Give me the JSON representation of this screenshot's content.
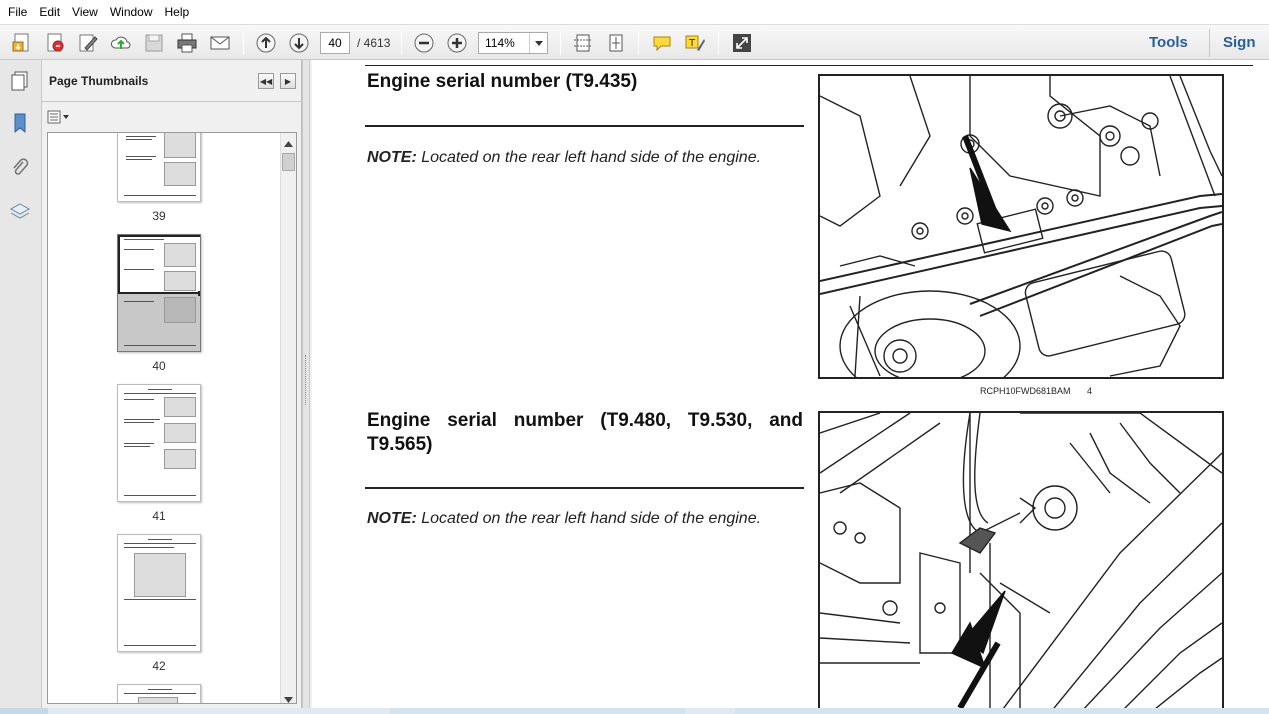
{
  "menu": [
    "File",
    "Edit",
    "View",
    "Window",
    "Help"
  ],
  "toolbar": {
    "icons": [
      "create-pdf-icon",
      "export-pdf-icon",
      "edit-icon",
      "upload-cloud-icon",
      "save-icon",
      "print-icon",
      "email-icon",
      "page-up-icon",
      "page-down-icon",
      "zoom-out-icon",
      "zoom-in-icon",
      "fit-width-icon",
      "fit-page-icon",
      "comment-icon",
      "highlight-icon",
      "expand-icon"
    ],
    "current_page": "40",
    "total_pages": "/ 4613",
    "zoom": "114%",
    "tools_label": "Tools",
    "sign_label": "Sign"
  },
  "panel": {
    "title": "Page Thumbnails",
    "thumbnails": [
      {
        "label": "39",
        "selected": false
      },
      {
        "label": "40",
        "selected": true
      },
      {
        "label": "41",
        "selected": false
      },
      {
        "label": "42",
        "selected": false
      }
    ]
  },
  "document": {
    "sections": [
      {
        "heading": "Engine serial number (T9.435)",
        "note_label": "NOTE:",
        "note_text": " Located on the rear left hand side of the engine.",
        "caption_code": "RCPH10FWD681BAM",
        "caption_num": "4"
      },
      {
        "heading": "Engine serial number (T9.480, T9.530, and T9.565)",
        "note_label": "NOTE:",
        "note_text": " Located on the rear left hand side of the engine."
      }
    ]
  }
}
